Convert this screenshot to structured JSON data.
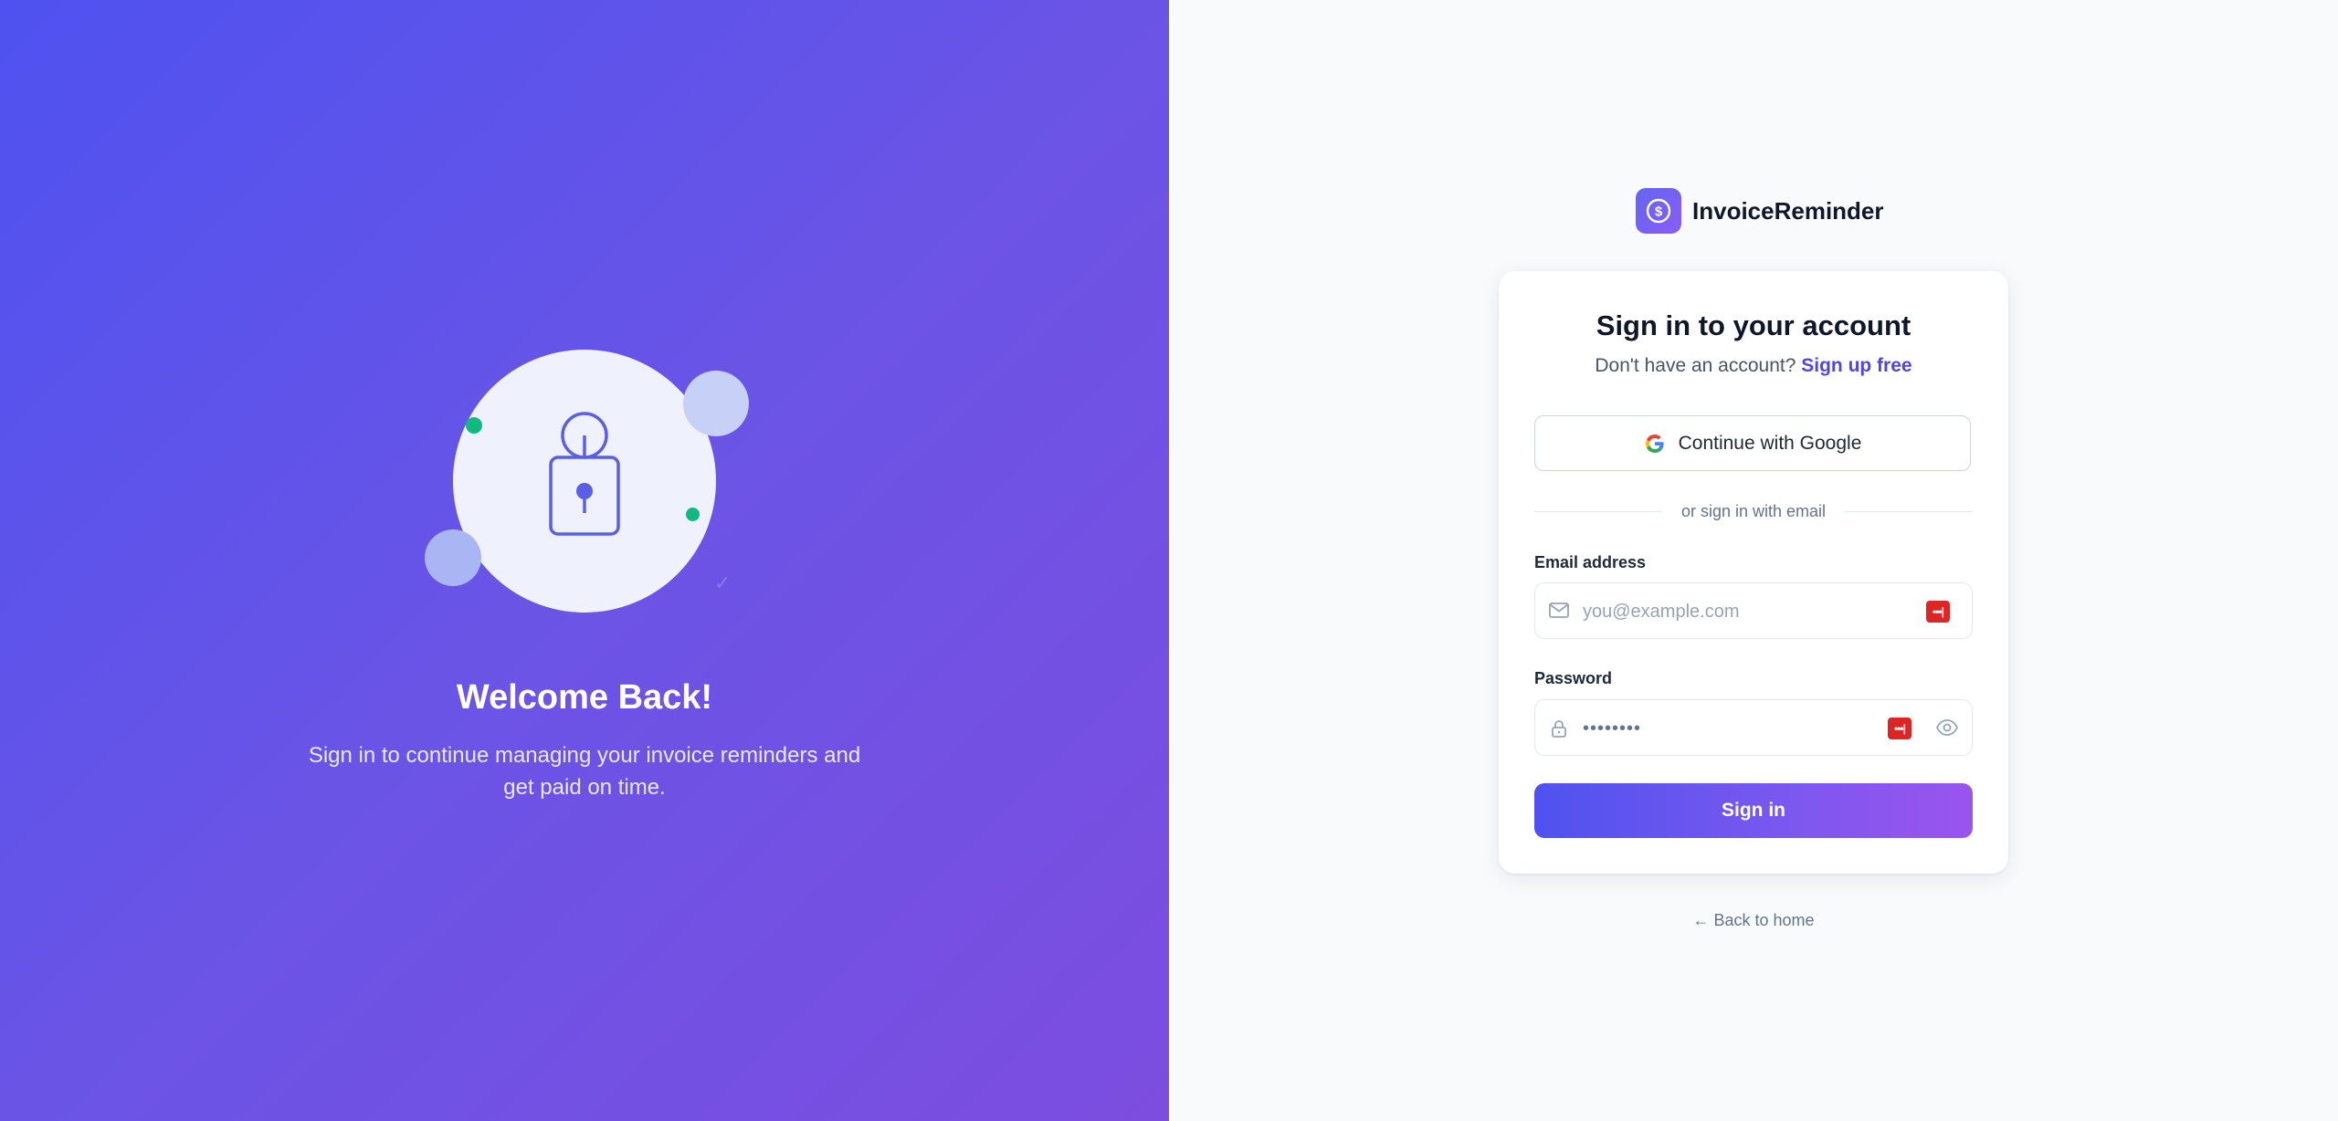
{
  "hero": {
    "title": "Welcome Back!",
    "subtitle": "Sign in to continue managing your invoice reminders and get paid on time."
  },
  "brand": {
    "name": "InvoiceReminder",
    "logo_icon": "dollar-circle-icon"
  },
  "form": {
    "title": "Sign in to your account",
    "subtitle_text": "Don't have an account? ",
    "signup_link": "Sign up free",
    "google_button": "Continue with Google",
    "divider_text": "or sign in with email",
    "email_label": "Email address",
    "email_placeholder": "you@example.com",
    "password_label": "Password",
    "password_value": "••••••••",
    "submit_label": "Sign in"
  },
  "footer": {
    "back_link": "← Back to home"
  },
  "colors": {
    "accent": "#4f46e5",
    "gradient_start": "#4f52f0",
    "gradient_end": "#7c4ddf",
    "success_dot": "#10b981"
  }
}
